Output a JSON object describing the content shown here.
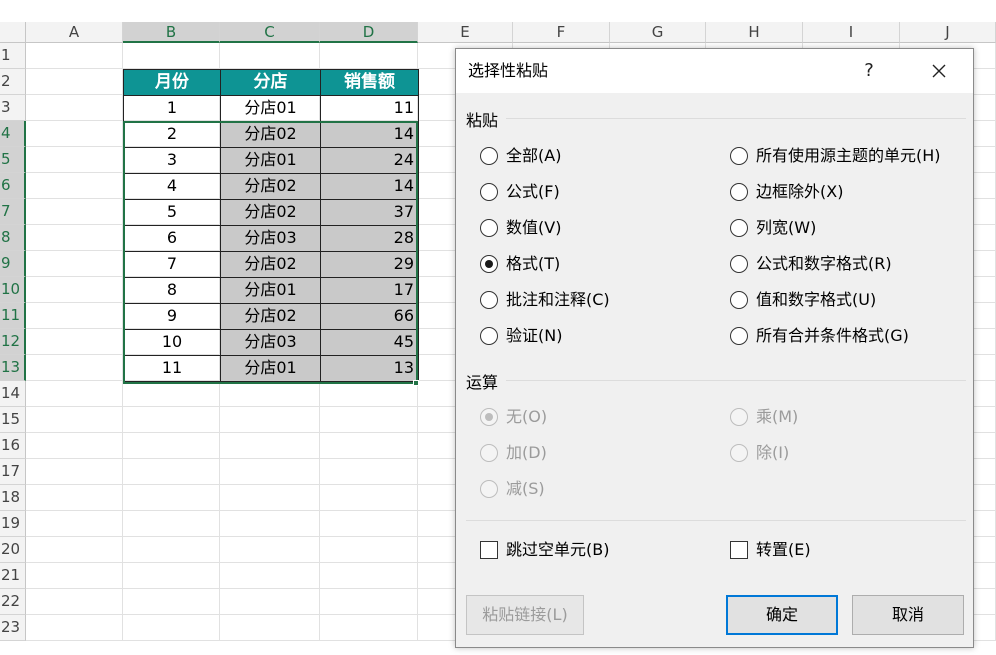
{
  "sheet": {
    "columns": [
      "A",
      "B",
      "C",
      "D",
      "E",
      "F",
      "G",
      "H",
      "I",
      "J"
    ],
    "rows": [
      "1",
      "2",
      "3",
      "4",
      "5",
      "6",
      "7",
      "8",
      "9",
      "10",
      "11",
      "12",
      "13",
      "14",
      "15",
      "16",
      "17",
      "18",
      "19",
      "20",
      "21",
      "22",
      "23"
    ],
    "table": {
      "headers": [
        "月份",
        "分店",
        "销售额"
      ],
      "rows": [
        [
          "1",
          "分店01",
          "11"
        ],
        [
          "2",
          "分店02",
          "14"
        ],
        [
          "3",
          "分店01",
          "24"
        ],
        [
          "4",
          "分店02",
          "14"
        ],
        [
          "5",
          "分店02",
          "37"
        ],
        [
          "6",
          "分店03",
          "28"
        ],
        [
          "7",
          "分店02",
          "29"
        ],
        [
          "8",
          "分店01",
          "17"
        ],
        [
          "9",
          "分店02",
          "66"
        ],
        [
          "10",
          "分店03",
          "45"
        ],
        [
          "11",
          "分店01",
          "13"
        ]
      ]
    },
    "colors": {
      "header_bg": "#0e9494",
      "selection": "#217346",
      "gray_cells": "#c9c9c9"
    }
  },
  "dialog": {
    "title": "选择性粘贴",
    "help_label": "?",
    "close_label": "✕",
    "paste_group": "粘贴",
    "paste_left": [
      "全部(A)",
      "公式(F)",
      "数值(V)",
      "格式(T)",
      "批注和注释(C)",
      "验证(N)"
    ],
    "paste_right": [
      "所有使用源主题的单元(H)",
      "边框除外(X)",
      "列宽(W)",
      "公式和数字格式(R)",
      "值和数字格式(U)",
      "所有合并条件格式(G)"
    ],
    "paste_selected": "格式(T)",
    "op_group": "运算",
    "op_left": [
      "无(O)",
      "加(D)",
      "减(S)"
    ],
    "op_right": [
      "乘(M)",
      "除(I)"
    ],
    "skip_blanks": "跳过空单元(B)",
    "transpose": "转置(E)",
    "paste_link": "粘贴链接(L)",
    "ok": "确定",
    "cancel": "取消"
  }
}
